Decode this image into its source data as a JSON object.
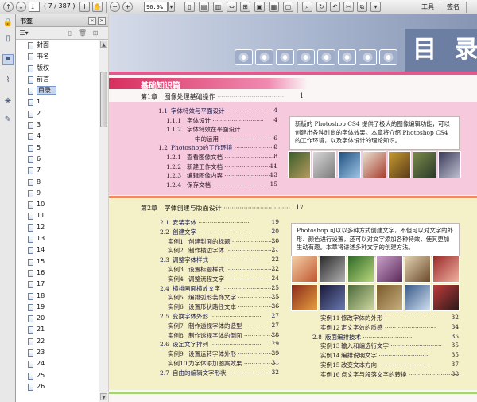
{
  "toolbar": {
    "current_page": "i",
    "page_count": "( 7 / 387 )",
    "zoom": "96.9%",
    "tools_label": "工具",
    "sign_label": "签名"
  },
  "bookmarks": {
    "title": "书签",
    "items": [
      "封面",
      "书名",
      "版权",
      "前言",
      "目录",
      "1",
      "2",
      "3",
      "4",
      "5",
      "6",
      "7",
      "8",
      "9",
      "10",
      "11",
      "12",
      "13",
      "14",
      "15",
      "16",
      "17",
      "18",
      "19",
      "20",
      "21",
      "22",
      "23",
      "24",
      "25",
      "26"
    ],
    "selected_index": 4
  },
  "page": {
    "banner_title": "目 录",
    "section_header": "基础知识篇",
    "chapter1": {
      "num": "第1章",
      "title": "图像处理基础操作",
      "page": "1"
    },
    "chapter1_entries": [
      {
        "num": "1.1",
        "title": "字体特效与平面设计",
        "page": "4",
        "level": 1
      },
      {
        "num": "1.1.1",
        "title": "字体设计",
        "page": "4",
        "level": 2
      },
      {
        "num": "1.1.2",
        "title": "字体特效在平面设计",
        "page": "",
        "level": 2
      },
      {
        "num": "",
        "title": "中的运用",
        "page": "6",
        "level": 3
      },
      {
        "num": "1.2",
        "title": "Photoshop的工作环境",
        "page": "8",
        "level": 1
      },
      {
        "num": "1.2.1",
        "title": "查看图像文档",
        "page": "8",
        "level": 2
      },
      {
        "num": "1.2.2",
        "title": "新建工作文档",
        "page": "11",
        "level": 2
      },
      {
        "num": "1.2.3",
        "title": "编辑图像内容",
        "page": "13",
        "level": 2
      },
      {
        "num": "1.2.4",
        "title": "保存文档",
        "page": "15",
        "level": 2
      }
    ],
    "blurb1": "新版的 Photoshop CS4 提供了极大的图像编辑功能，可以创建出各种时尚的字体效果。本章将介绍 Photoshop CS4 的工作环境，以及字体设计的理论知识。",
    "chapter2": {
      "num": "第2章",
      "title": "字体创建与版面设计",
      "page": "17"
    },
    "chapter2_entries": [
      {
        "num": "2.1",
        "title": "安装字体",
        "page": "19",
        "level": 1
      },
      {
        "num": "2.2",
        "title": "创建文字",
        "page": "20",
        "level": 1
      },
      {
        "num": "实例1",
        "title": "创建封面的标题",
        "page": "20",
        "level": 2
      },
      {
        "num": "实例2",
        "title": "制作横边字体",
        "page": "21",
        "level": 2
      },
      {
        "num": "2.3",
        "title": "调整字体样式",
        "page": "22",
        "level": 1
      },
      {
        "num": "实例3",
        "title": "设置标题样式",
        "page": "22",
        "level": 2
      },
      {
        "num": "实例4",
        "title": "调整流程文字",
        "page": "24",
        "level": 2
      },
      {
        "num": "2.4",
        "title": "横排画面横放文字",
        "page": "25",
        "level": 1
      },
      {
        "num": "实例5",
        "title": "编排弧形装饰文字",
        "page": "25",
        "level": 2
      },
      {
        "num": "实例6",
        "title": "设置形状路径文本",
        "page": "26",
        "level": 2
      },
      {
        "num": "2.5",
        "title": "变换字体外形",
        "page": "27",
        "level": 1
      },
      {
        "num": "实例7",
        "title": "制作透视字体的造型",
        "page": "27",
        "level": 2
      },
      {
        "num": "实例8",
        "title": "制作透视字体的倒面",
        "page": "28",
        "level": 2
      },
      {
        "num": "2.6",
        "title": "设定文字排列",
        "page": "29",
        "level": 1
      },
      {
        "num": "实例9",
        "title": "设置运转字体外形",
        "page": "29",
        "level": 2
      },
      {
        "num": "实例10",
        "title": "为字体添加图案效果",
        "page": "31",
        "level": 2
      },
      {
        "num": "2.7",
        "title": "自由的编辑文字形状",
        "page": "32",
        "level": 1
      }
    ],
    "blurb2": "Photoshop 可以以多种方式创建文字，不但可以对文字的外形、颜色进行设置，还可以对文字添加各种特效，使其更加生动有趣。本章将讲述多种文字的创建方法。",
    "chapter2_right_entries": [
      {
        "num": "实例11",
        "title": "修改字体的外形",
        "page": "32",
        "level": 2
      },
      {
        "num": "实例12",
        "title": "定文字效的质感",
        "page": "34",
        "level": 2
      },
      {
        "num": "2.8",
        "title": "版面编排技术",
        "page": "35",
        "level": 1
      },
      {
        "num": "实例13",
        "title": "输入和编选行文字",
        "page": "35",
        "level": 2
      },
      {
        "num": "实例14",
        "title": "编排说明文字",
        "page": "35",
        "level": 2
      },
      {
        "num": "实例15",
        "title": "改变文本方向",
        "page": "37",
        "level": 2
      },
      {
        "num": "实例16",
        "title": "点文字与段落文字的转换",
        "page": "38",
        "level": 2
      }
    ]
  },
  "colors": {
    "accent_pink": "#d72f5f",
    "zone1_bg": "#f6c9dc",
    "zone2_bg": "#f4f1c8",
    "banner_blue": "#6d7ea3"
  }
}
